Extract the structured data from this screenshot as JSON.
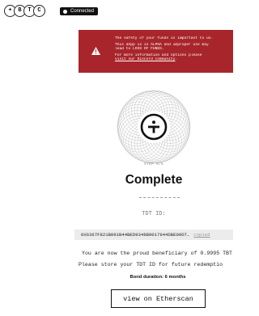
{
  "header": {
    "logo_letters": [
      "+",
      "B",
      "T",
      "C"
    ],
    "connection_status": "Connected"
  },
  "warning": {
    "icon": "warning-triangle-icon",
    "title": "The safety of your funds is important to us.",
    "alpha_line1": "This dApp is in ALPHA and improper use may",
    "alpha_line2": "lead to LOSS OF FUNDS.",
    "info_line1": "For more information and options please",
    "info_link": "visit our Discord community",
    "info_suffix": ".",
    "background_color": "#a8262b"
  },
  "medallion": {
    "icon": "tdt-logo-icon"
  },
  "step": "STEP 5/5",
  "status_title": "Complete",
  "tdt_label": "TDT ID:",
  "tdt_id": {
    "value": "0X6367F821B091B44BED9348B9017944DBE00D7…",
    "copied_label": "copied"
  },
  "message": {
    "line1": "You are now the proud beneficiary of 0.9995 TBT",
    "line2": "Please store your TDT ID for future redemptio"
  },
  "bond_duration": "Bond duration: 6 months",
  "etherscan_button": "view on Etherscan"
}
